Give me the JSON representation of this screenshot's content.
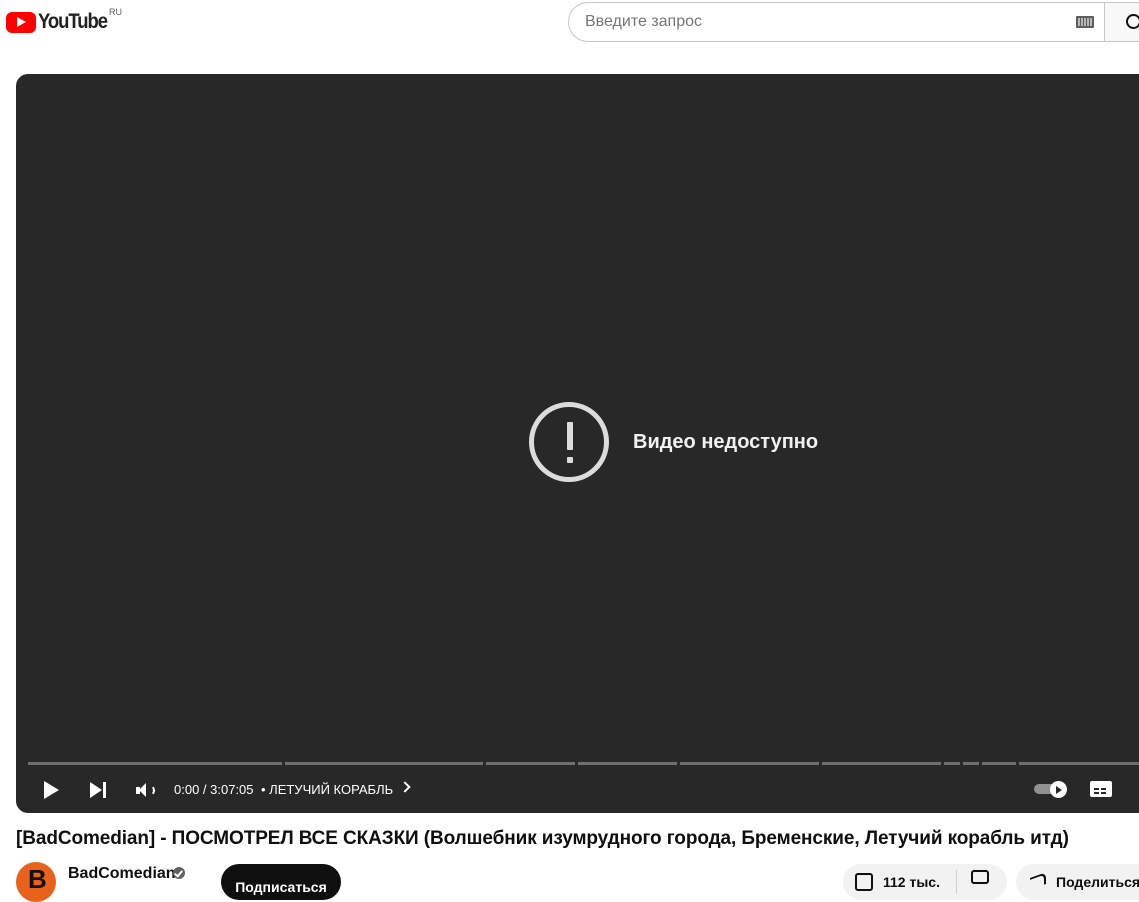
{
  "header": {
    "logo_text": "YouTube",
    "country_code": "RU",
    "search_placeholder": "Введите запрос"
  },
  "player": {
    "error_message": "Видео недоступно",
    "time_display": "0:00 / 3:07:05",
    "chapter_title": "• ЛЕТУЧИЙ КОРАБЛЬ",
    "autoplay_on": true
  },
  "video": {
    "title": "[BadComedian] - ПОСМОТРЕЛ ВСЕ СКАЗКИ (Волшебник изумрудного города, Бременские, Летучий корабль итд)",
    "channel_name": "BadComedian",
    "subscribe_label": "Подписаться",
    "like_count": "112 тыс.",
    "share_label": "Поделиться"
  },
  "colors": {
    "brand": "#ff0000",
    "player_bg": "#282828",
    "subscribe_bg": "#0f0f0f"
  }
}
